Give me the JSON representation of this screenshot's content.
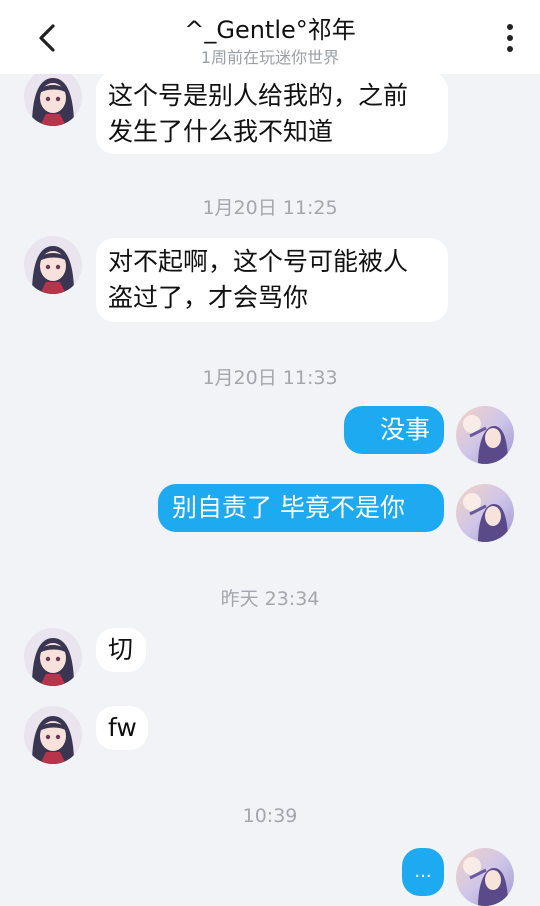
{
  "header": {
    "title": "^_Gentle°祁年",
    "subtitle": "1周前在玩迷你世界",
    "back_icon": "chevron-left-icon",
    "more_icon": "more-vertical-icon"
  },
  "messages": [
    {
      "type": "in",
      "text": "这个号是别人给我的，之前\n发生了什么我不知道"
    },
    {
      "type": "time",
      "text": "1月20日 11:25"
    },
    {
      "type": "in",
      "text": "对不起啊，这个号可能被人\n盗过了，才会骂你"
    },
    {
      "type": "time",
      "text": "1月20日 11:33"
    },
    {
      "type": "out",
      "text": "没事"
    },
    {
      "type": "out",
      "text": "别自责了 毕竟不是你"
    },
    {
      "type": "time",
      "text": "昨天 23:34"
    },
    {
      "type": "in",
      "text": "切"
    },
    {
      "type": "in",
      "text": "fw"
    },
    {
      "type": "time",
      "text": "10:39"
    },
    {
      "type": "out",
      "text": "..."
    }
  ],
  "colors": {
    "background": "#f1f3f6",
    "incoming_bubble": "#ffffff",
    "outgoing_bubble": "#1eaaf1"
  }
}
